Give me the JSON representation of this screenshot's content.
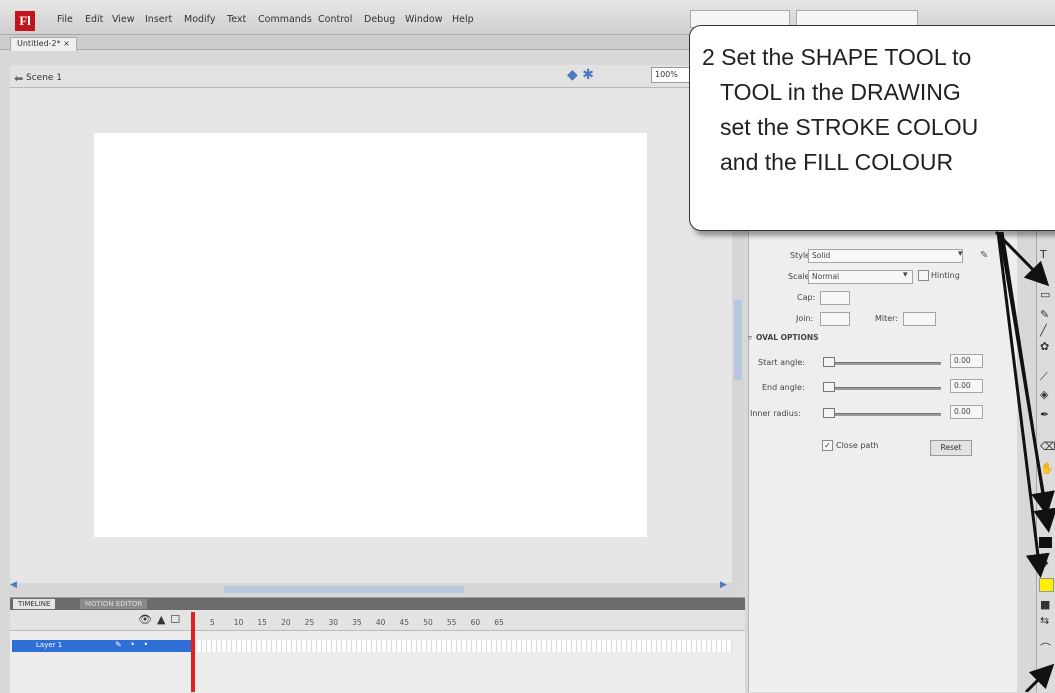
{
  "app": {
    "logo_letter": "Fl"
  },
  "menu": {
    "items": [
      "File",
      "Edit",
      "View",
      "Insert",
      "Modify",
      "Text",
      "Commands",
      "Control",
      "Debug",
      "Window",
      "Help"
    ]
  },
  "document": {
    "tab_label": "Untitled-2* ×",
    "scene_label": "Scene 1",
    "zoom": "100%"
  },
  "timeline": {
    "tab_timeline": "TIMELINE",
    "tab_motion": "MOTION EDITOR",
    "layer_name": "Layer 1",
    "frame_numbers": [
      "5",
      "10",
      "15",
      "20",
      "25",
      "30",
      "35",
      "40",
      "45",
      "50",
      "55",
      "60",
      "65"
    ]
  },
  "properties": {
    "style_label": "Style:",
    "style_value": "Solid",
    "scale_label": "Scale:",
    "scale_value": "Normal",
    "hinting_label": "Hinting",
    "cap_label": "Cap:",
    "join_label": "Join:",
    "miter_label": "Miter:",
    "oval_options_title": "OVAL OPTIONS",
    "start_angle_label": "Start angle:",
    "start_angle_value": "0.00",
    "end_angle_label": "End angle:",
    "end_angle_value": "0.00",
    "inner_radius_label": "Inner radius:",
    "inner_radius_value": "0.00",
    "close_path_label": "Close path",
    "reset_label": "Reset"
  },
  "callout": {
    "lines": [
      "2  Set the SHAPE TOOL to",
      "TOOL in the DRAWING",
      "set the STROKE COLOU",
      "and the FILL COLOUR"
    ]
  },
  "colors": {
    "fill_swatch": "#ffee00",
    "stroke_swatch": "#111111",
    "playhead": "#e02020",
    "layer_selected": "#2f6fd6"
  }
}
